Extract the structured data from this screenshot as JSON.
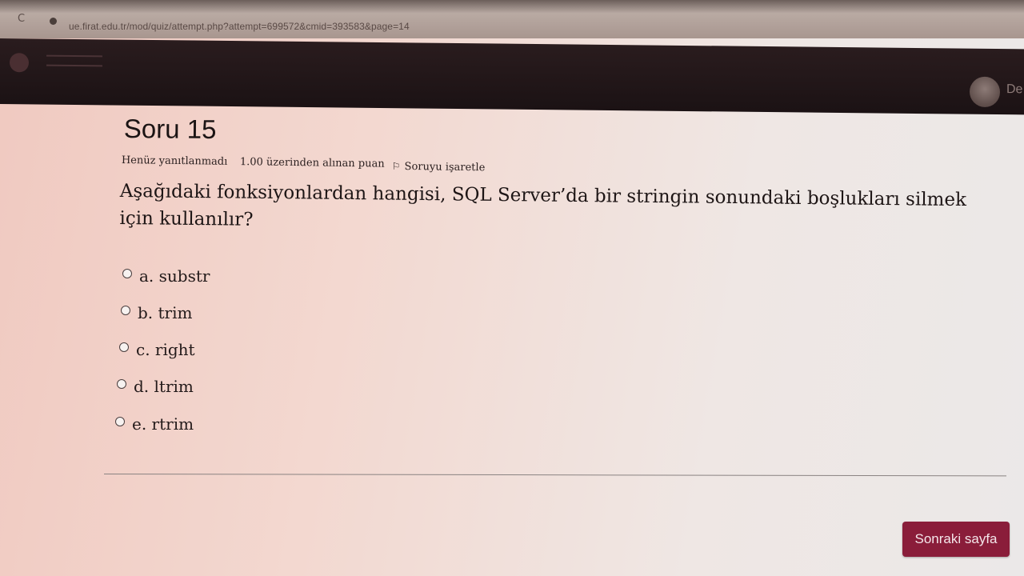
{
  "browser": {
    "url": "ue.firat.edu.tr/mod/quiz/attempt.php?attempt=699572&cmid=393583&page=14"
  },
  "header": {
    "user_name": "De"
  },
  "question": {
    "title": "Soru 15",
    "status": "Henüz yanıtlanmadı",
    "points": "1.00 üzerinden alınan puan",
    "flag_label": "Soruyu işaretle",
    "text": "Aşağıdaki fonksiyonlardan hangisi, SQL Server’da bir stringin sonundaki boşlukları silmek için kullanılır?",
    "options": [
      {
        "label": "a. substr"
      },
      {
        "label": "b. trim"
      },
      {
        "label": "c. right"
      },
      {
        "label": "d. ltrim"
      },
      {
        "label": "e. rtrim"
      }
    ]
  },
  "navigation": {
    "next_label": "Sonraki sayfa"
  },
  "colors": {
    "header_bg": "#1b1214",
    "next_button_bg": "#8a1d3a"
  }
}
